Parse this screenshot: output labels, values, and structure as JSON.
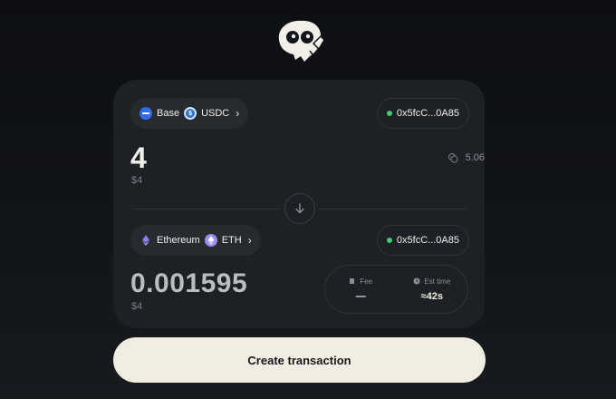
{
  "logo": {
    "icon": "ghost-mascot-logo-icon"
  },
  "source": {
    "chain": "Base",
    "chain_color": "#2f6bf0",
    "token": "USDC",
    "token_color": "#2a78d4",
    "address": "0x5fcC...0A85",
    "amount": "4",
    "amount_usd": "$4",
    "balance": "5.06"
  },
  "destination": {
    "chain": "Ethereum",
    "chain_color": "#8a7ff0",
    "token": "ETH",
    "token_color": "#9b8cf5",
    "address": "0x5fcC...0A85",
    "amount": "0.001595",
    "amount_usd": "$4"
  },
  "info": {
    "fee_label": "Fee",
    "fee_value": "—",
    "time_label": "Est time",
    "time_value": "≈42s"
  },
  "cta_label": "Create transaction",
  "colors": {
    "background": "#111418",
    "card": "#1d2024",
    "accent_green": "#3ecf6a",
    "cta": "#f1ede3"
  }
}
